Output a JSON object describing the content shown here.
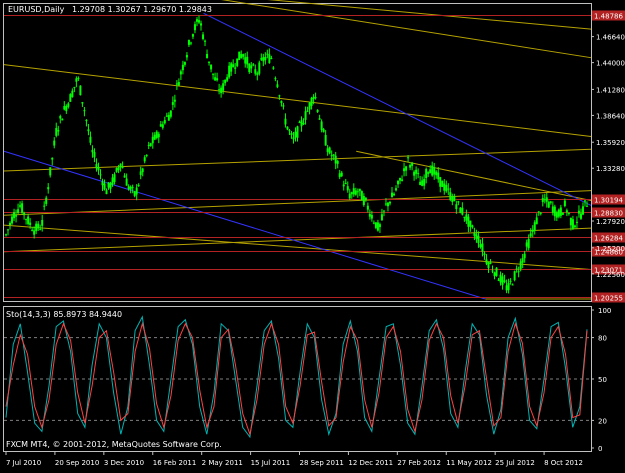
{
  "chart_data": [
    {
      "type": "candlestick",
      "panel": "price",
      "symbol_label": "EURUSD,Daily",
      "ohlc_label": "1.29708 1.30267 1.29670 1.29843",
      "x_tick_labels": [
        "7 Jul 2010",
        "20 Sep 2010",
        "3 Dec 2010",
        "16 Feb 2011",
        "2 May 2011",
        "15 Jul 2011",
        "28 Sep 2011",
        "12 Dec 2011",
        "27 Feb 2012",
        "11 May 2012",
        "25 Jul 2012",
        "8 Oct 2012"
      ],
      "y_tick_labels": [
        "1.46640",
        "1.44000",
        "1.41280",
        "1.38640",
        "1.35920",
        "1.33280",
        "1.27920",
        "1.25200",
        "1.22560"
      ],
      "price_badges": [
        {
          "value": "1.48786",
          "price": 1.48786,
          "color": "#b22222"
        },
        {
          "value": "1.30194",
          "price": 1.30194,
          "color": "#b22222"
        },
        {
          "value": "1.28830",
          "price": 1.2883,
          "color": "#b22222"
        },
        {
          "value": "1.26284",
          "price": 1.26284,
          "color": "#b22222"
        },
        {
          "value": "1.24860",
          "price": 1.2486,
          "color": "#b22222"
        },
        {
          "value": "1.23071",
          "price": 1.23071,
          "color": "#b22222"
        },
        {
          "value": "1.20255",
          "price": 1.20255,
          "color": "#b22222"
        }
      ],
      "ylim": [
        1.198,
        1.4995
      ],
      "series_color": "#00ff00",
      "closes": [
        1.265,
        1.285,
        1.295,
        1.28,
        1.27,
        1.275,
        1.32,
        1.37,
        1.39,
        1.405,
        1.425,
        1.39,
        1.35,
        1.33,
        1.31,
        1.32,
        1.34,
        1.315,
        1.305,
        1.33,
        1.355,
        1.365,
        1.38,
        1.39,
        1.42,
        1.445,
        1.47,
        1.485,
        1.45,
        1.425,
        1.41,
        1.43,
        1.44,
        1.45,
        1.435,
        1.43,
        1.445,
        1.445,
        1.415,
        1.38,
        1.36,
        1.375,
        1.39,
        1.41,
        1.375,
        1.35,
        1.34,
        1.32,
        1.305,
        1.31,
        1.3,
        1.285,
        1.27,
        1.295,
        1.305,
        1.32,
        1.34,
        1.33,
        1.315,
        1.335,
        1.325,
        1.315,
        1.305,
        1.295,
        1.285,
        1.27,
        1.26,
        1.24,
        1.23,
        1.22,
        1.21,
        1.225,
        1.24,
        1.26,
        1.28,
        1.3,
        1.295,
        1.285,
        1.295,
        1.275,
        1.285,
        1.2984
      ],
      "trend_lines": [
        {
          "color": "#b5a200",
          "from": [
            0,
            1.438
          ],
          "to": [
            1,
            1.365
          ]
        },
        {
          "color": "#b5a200",
          "from": [
            0.34,
            1.51
          ],
          "to": [
            1,
            1.474
          ]
        },
        {
          "color": "#b5a200",
          "from": [
            0.36,
            1.505
          ],
          "to": [
            1,
            1.445
          ]
        },
        {
          "color": "#b5a200",
          "from": [
            0.6,
            1.35
          ],
          "to": [
            1,
            1.3
          ]
        },
        {
          "color": "#b5a200",
          "from": [
            0,
            1.33
          ],
          "to": [
            1,
            1.352
          ]
        },
        {
          "color": "#b5a200",
          "from": [
            0,
            1.285
          ],
          "to": [
            1,
            1.31
          ]
        },
        {
          "color": "#b5a200",
          "from": [
            0,
            1.275
          ],
          "to": [
            1,
            1.23
          ]
        },
        {
          "color": "#b5a200",
          "from": [
            0,
            1.248
          ],
          "to": [
            1,
            1.272
          ]
        },
        {
          "color": "#b5a200",
          "from": [
            0.82,
            1.2
          ],
          "to": [
            1,
            1.2
          ]
        },
        {
          "color": "#3333ff",
          "from": [
            0.34,
            1.49
          ],
          "to": [
            1,
            1.295
          ]
        },
        {
          "color": "#3333ff",
          "from": [
            0,
            1.35
          ],
          "to": [
            0.82,
            1.2
          ]
        }
      ],
      "horizontal_lines_color": "#b22222"
    },
    {
      "type": "line",
      "panel": "oscillator",
      "indicator_label": "Sto(14,3,3) 85.8973 84.9440",
      "y_tick_labels": [
        "100",
        "80",
        "50",
        "20",
        "0"
      ],
      "ylim": [
        0,
        100
      ],
      "levels": [
        20,
        50,
        80
      ],
      "series": [
        {
          "color": "#00b4b4",
          "values": [
            22,
            75,
            90,
            55,
            18,
            12,
            45,
            88,
            92,
            70,
            25,
            15,
            60,
            90,
            80,
            40,
            10,
            30,
            85,
            95,
            60,
            20,
            12,
            50,
            88,
            93,
            75,
            30,
            10,
            40,
            90,
            85,
            50,
            15,
            8,
            45,
            85,
            92,
            65,
            20,
            15,
            55,
            90,
            80,
            35,
            10,
            25,
            75,
            92,
            70,
            22,
            12,
            50,
            88,
            90,
            60,
            18,
            10,
            45,
            85,
            93,
            72,
            25,
            15,
            55,
            90,
            82,
            38,
            10,
            28,
            80,
            94,
            68,
            20,
            14,
            50,
            88,
            91,
            58,
            15,
            30,
            86
          ]
        },
        {
          "color": "#ff4040",
          "values": [
            30,
            60,
            82,
            68,
            30,
            15,
            35,
            75,
            90,
            78,
            40,
            18,
            45,
            80,
            85,
            55,
            20,
            25,
            70,
            90,
            72,
            32,
            15,
            38,
            78,
            90,
            80,
            42,
            15,
            30,
            80,
            86,
            60,
            25,
            10,
            35,
            75,
            90,
            75,
            30,
            18,
            45,
            82,
            84,
            48,
            16,
            22,
            62,
            88,
            78,
            35,
            15,
            40,
            80,
            88,
            70,
            28,
            12,
            35,
            78,
            90,
            80,
            38,
            18,
            45,
            82,
            85,
            50,
            16,
            22,
            70,
            90,
            76,
            30,
            16,
            40,
            80,
            88,
            68,
            22,
            24,
            85
          ]
        }
      ]
    }
  ],
  "footer": {
    "copyright": "FXCM MT4, © 2001-2012, MetaQuotes Software Corp."
  }
}
